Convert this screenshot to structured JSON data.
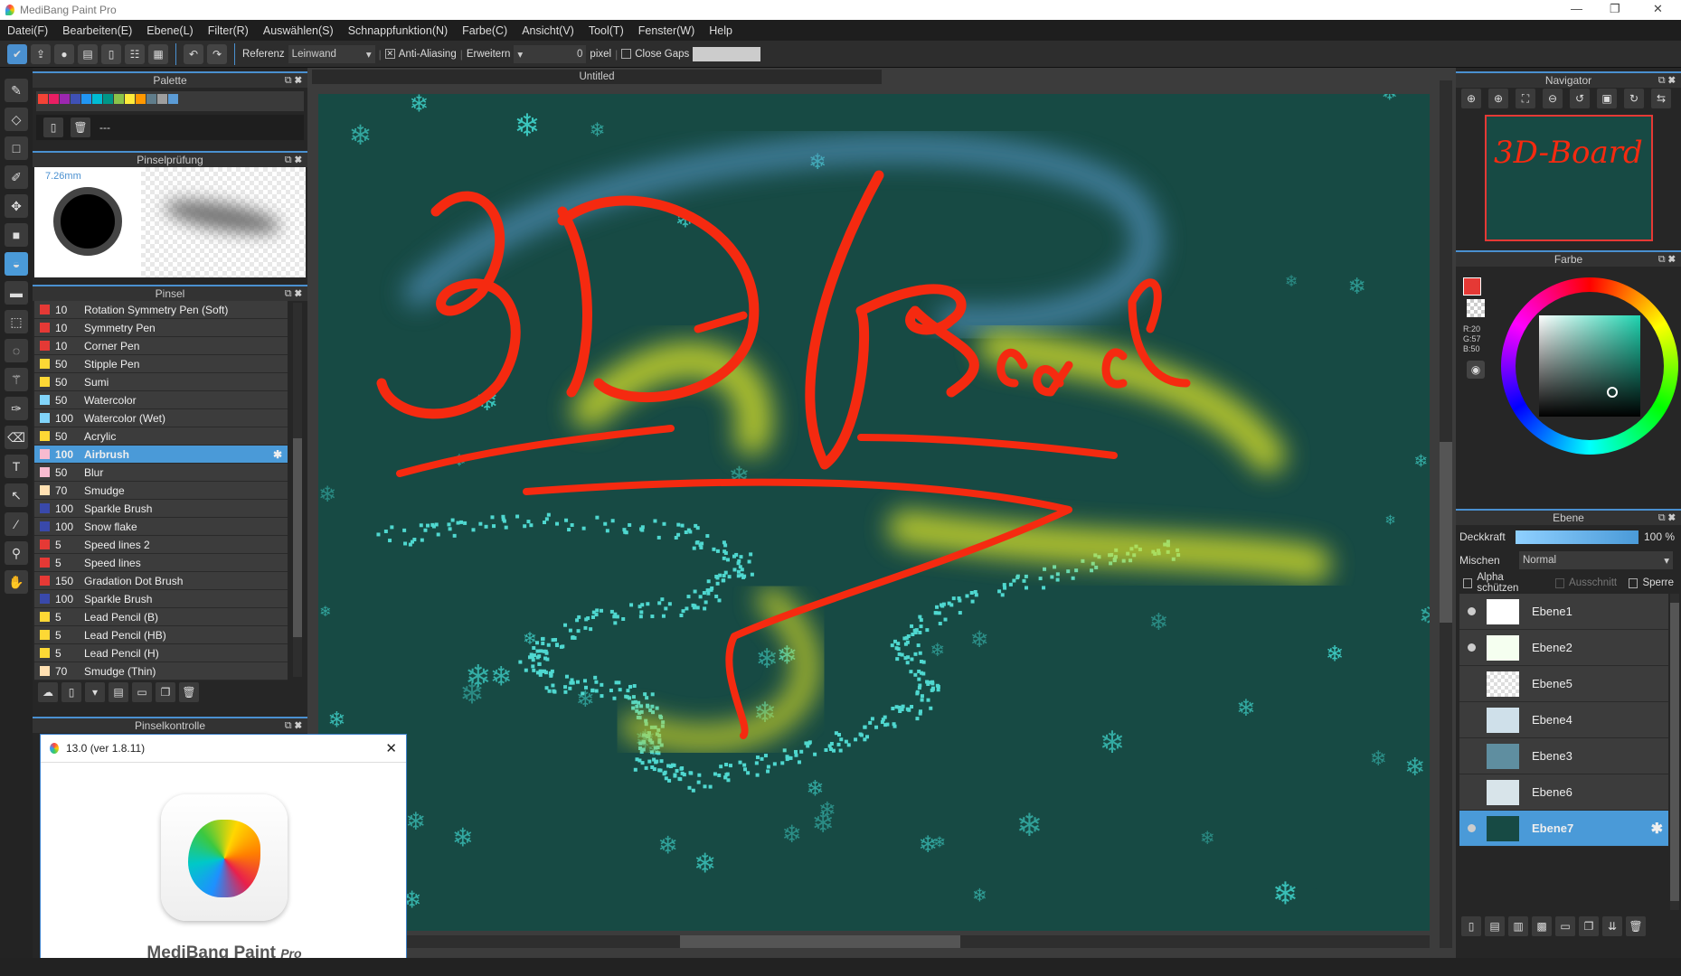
{
  "app": {
    "title": "MediBang Paint Pro",
    "minimize": "—",
    "restore": "❐",
    "close": "✕"
  },
  "menu": [
    "Datei(F)",
    "Bearbeiten(E)",
    "Ebene(L)",
    "Filter(R)",
    "Auswählen(S)",
    "Schnappfunktion(N)",
    "Farbe(C)",
    "Ansicht(V)",
    "Tool(T)",
    "Fenster(W)",
    "Help"
  ],
  "toolbar": {
    "referenz_label": "Referenz",
    "referenz_value": "Leinwand",
    "anti_aliasing": "Anti-Aliasing",
    "anti_aliasing_checked": true,
    "erweitern_label": "Erweitern",
    "erweitern_value": "0",
    "pixel_label": "pixel",
    "close_gaps": "Close Gaps",
    "close_gaps_checked": false
  },
  "palette": {
    "title": "Palette",
    "colors": [
      "#f44336",
      "#e91e63",
      "#9c27b0",
      "#3f51b5",
      "#2196f3",
      "#00bcd4",
      "#009688",
      "#8bc34a",
      "#ffeb3b",
      "#ff9800",
      "#607d8b",
      "#9e9e9e",
      "#5b9bd5"
    ],
    "name": "---"
  },
  "brush_preview": {
    "title": "Pinselprüfung",
    "size": "7.26mm"
  },
  "brushes": {
    "title": "Pinsel",
    "items": [
      {
        "size": "10",
        "name": "Rotation Symmetry Pen (Soft)",
        "color": "#e53935"
      },
      {
        "size": "10",
        "name": "Symmetry Pen",
        "color": "#e53935"
      },
      {
        "size": "10",
        "name": "Corner Pen",
        "color": "#e53935"
      },
      {
        "size": "50",
        "name": "Stipple Pen",
        "color": "#fdd835"
      },
      {
        "size": "50",
        "name": "Sumi",
        "color": "#fdd835"
      },
      {
        "size": "50",
        "name": "Watercolor",
        "color": "#81d4fa"
      },
      {
        "size": "100",
        "name": "Watercolor (Wet)",
        "color": "#81d4fa"
      },
      {
        "size": "50",
        "name": "Acrylic",
        "color": "#fdd835"
      },
      {
        "size": "100",
        "name": "Airbrush",
        "color": "#f8bbd0",
        "selected": true
      },
      {
        "size": "50",
        "name": "Blur",
        "color": "#f8bbd0"
      },
      {
        "size": "70",
        "name": "Smudge",
        "color": "#ffe0b2"
      },
      {
        "size": "100",
        "name": "Sparkle Brush",
        "color": "#3949ab"
      },
      {
        "size": "100",
        "name": "Snow flake",
        "color": "#3949ab"
      },
      {
        "size": "5",
        "name": "Speed lines 2",
        "color": "#e53935"
      },
      {
        "size": "5",
        "name": "Speed lines",
        "color": "#e53935"
      },
      {
        "size": "150",
        "name": "Gradation Dot Brush",
        "color": "#e53935"
      },
      {
        "size": "100",
        "name": "Sparkle Brush",
        "color": "#3949ab"
      },
      {
        "size": "5",
        "name": "Lead Pencil (B)",
        "color": "#fdd835"
      },
      {
        "size": "5",
        "name": "Lead Pencil (HB)",
        "color": "#fdd835"
      },
      {
        "size": "5",
        "name": "Lead Pencil (H)",
        "color": "#fdd835"
      },
      {
        "size": "70",
        "name": "Smudge (Thin)",
        "color": "#ffe0b2"
      }
    ]
  },
  "brush_control": {
    "title": "Pinselkontrolle"
  },
  "about": {
    "title": "13.0 (ver 1.8.11)",
    "brand": "MediBang Paint",
    "brand_suffix": "Pro",
    "close": "✕"
  },
  "canvas": {
    "tab": "Untitled",
    "artwork_text": "3D-Board",
    "bg": "#174a44",
    "stroke": "#f52a10"
  },
  "navigator": {
    "title": "Navigator"
  },
  "color": {
    "title": "Farbe",
    "r": "R:20",
    "g": "G:57",
    "b": "B:50",
    "fg": "#e53935"
  },
  "layers": {
    "title": "Ebene",
    "opacity_label": "Deckkraft",
    "opacity_value": "100 %",
    "opacity": 1.0,
    "blend_label": "Mischen",
    "blend_value": "Normal",
    "alpha_lock": "Alpha schützen",
    "clipping": "Ausschnitt",
    "lock": "Sperre",
    "items": [
      {
        "name": "Ebene1",
        "visible": true
      },
      {
        "name": "Ebene2",
        "visible": true
      },
      {
        "name": "Ebene5",
        "visible": false
      },
      {
        "name": "Ebene4",
        "visible": false
      },
      {
        "name": "Ebene3",
        "visible": false
      },
      {
        "name": "Ebene6",
        "visible": false
      },
      {
        "name": "Ebene7",
        "visible": true,
        "selected": true
      }
    ]
  }
}
